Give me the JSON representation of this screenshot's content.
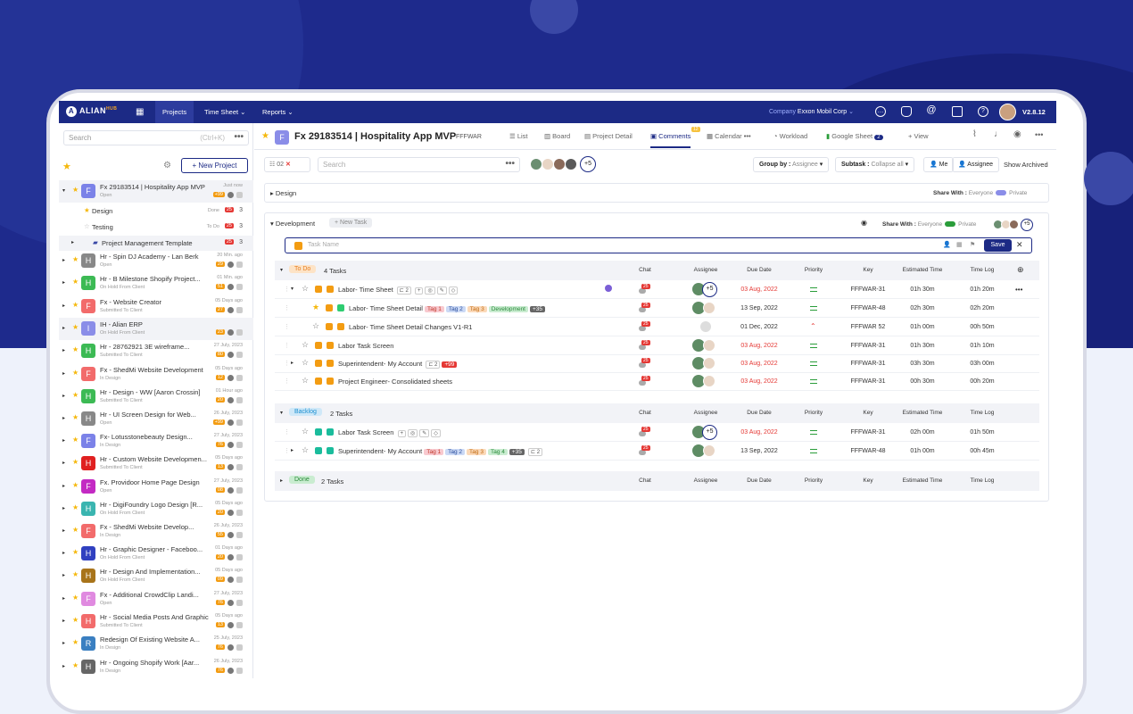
{
  "nav": {
    "logo": "ALIAN",
    "logo_sup": "HUB",
    "tabs": [
      "Projects",
      "Time Sheet",
      "Reports"
    ],
    "company_label": "Company",
    "company_name": "Exxon Mobil Corp",
    "version": "V2.8.12"
  },
  "sidebar": {
    "search_placeholder": "Search",
    "search_shortcut": "(Ctrl+K)",
    "new_project": "+ New Project",
    "projects": [
      {
        "letter": "F",
        "color": "#7b82e8",
        "name": "Fx 29183514 | Hospitality App MVP",
        "status": "Open",
        "time": "Just now",
        "count": "+99"
      },
      {
        "letter": "H",
        "color": "#888888",
        "name": "Hr - Spin DJ Academy - Lan Berk",
        "status": "Open",
        "time": "20 Min. ago",
        "count": "29"
      },
      {
        "letter": "H",
        "color": "#3cba54",
        "name": "Hr - B Milestone Shopify Project...",
        "status": "On Hold From Client",
        "time": "01 Min. ago",
        "count": "51"
      },
      {
        "letter": "F",
        "color": "#f26b6b",
        "name": "Fx - Website Creator",
        "status": "Submitted To Client",
        "time": "05 Days ago",
        "count": "27"
      },
      {
        "letter": "I",
        "color": "#8a8de8",
        "name": "IH - Alian ERP",
        "status": "On Hold From Client",
        "time": "",
        "count": "23"
      },
      {
        "letter": "H",
        "color": "#3cba54",
        "name": "Hr - 28762921 3E wireframe...",
        "status": "Submitted To Client",
        "time": "27 July, 2023",
        "count": "80"
      },
      {
        "letter": "F",
        "color": "#f26b6b",
        "name": "Fx - ShedMi Website Development",
        "status": "In Design",
        "time": "05 Days ago",
        "count": "12"
      },
      {
        "letter": "H",
        "color": "#3cba54",
        "name": "Hr - Design - WW [Aaron Crossin]",
        "status": "Submitted To Client",
        "time": "01 Hour ago",
        "count": "20"
      },
      {
        "letter": "H",
        "color": "#888888",
        "name": "Hr - UI Screen Design for Web...",
        "status": "Open",
        "time": "26 July, 2023",
        "count": "+99"
      },
      {
        "letter": "F",
        "color": "#7b82e8",
        "name": "Fx- Lotusstonebeauty Design...",
        "status": "In Design",
        "time": "27 July, 2023",
        "count": "76"
      },
      {
        "letter": "H",
        "color": "#e02020",
        "name": "Hr - Custom Website Developmen...",
        "status": "Submitted To Client",
        "time": "05 Days ago",
        "count": "13"
      },
      {
        "letter": "F",
        "color": "#c32ac3",
        "name": "Fx. Providoor Home Page Design",
        "status": "Open",
        "time": "27 July, 2023",
        "count": "08"
      },
      {
        "letter": "H",
        "color": "#3ab5b0",
        "name": "Hr - DigiFoundry Logo Design [R...",
        "status": "On Hold From Client",
        "time": "05 Days ago",
        "count": "20"
      },
      {
        "letter": "F",
        "color": "#f26b6b",
        "name": "Fx - ShedMi Website Develop...",
        "status": "In Design",
        "time": "26 July, 2023",
        "count": "55"
      },
      {
        "letter": "H",
        "color": "#3040c0",
        "name": "Hr - Graphic Designer - Faceboo...",
        "status": "On Hold From Client",
        "time": "01 Days ago",
        "count": "20"
      },
      {
        "letter": "H",
        "color": "#a8741a",
        "name": "Hr - Design And Implementation...",
        "status": "On Hold From Client",
        "time": "05 Days ago",
        "count": "09"
      },
      {
        "letter": "F",
        "color": "#e08ae0",
        "name": "Fx - Additional CrowdClip Landi...",
        "status": "Open",
        "time": "27 July, 2023",
        "count": "76"
      },
      {
        "letter": "H",
        "color": "#f26b6b",
        "name": "Hr - Social Media Posts And Graphic",
        "status": "Submitted To Client",
        "time": "05 Days ago",
        "count": "13"
      },
      {
        "letter": "R",
        "color": "#3a7fc1",
        "name": "Redesign Of Existing Website A...",
        "status": "In Design",
        "time": "25 July, 2023",
        "count": "76"
      },
      {
        "letter": "H",
        "color": "#666666",
        "name": "Hr - Ongoing Shopify Work [Aar...",
        "status": "In Design",
        "time": "26 July, 2023",
        "count": "76"
      }
    ],
    "sub": [
      {
        "name": "Design",
        "status": "Done",
        "count": "25",
        "n": "3"
      },
      {
        "name": "Testing",
        "status": "To Do",
        "count": "25",
        "n": "3"
      },
      {
        "name": "Project Management Template",
        "status": "",
        "count": "25",
        "n": "3"
      }
    ]
  },
  "header": {
    "letter": "F",
    "title": "Fx 29183514 | Hospitality App MVP",
    "code": "FFFWAR",
    "tabs": [
      "List",
      "Board",
      "Project Detail",
      "Comments",
      "Calendar",
      "Workload",
      "Google Sheet",
      "+ View"
    ],
    "gs_badge": "2",
    "comments_badge": "12"
  },
  "toolbar": {
    "filter_count": "02",
    "search": "Search",
    "plus": "+5",
    "group_by": "Group by :",
    "group_val": "Assignee",
    "subtask": "Subtask :",
    "subtask_val": "Collapse all",
    "me": "Me",
    "assignee": "Assignee",
    "archived": "Show Archived"
  },
  "design": {
    "label": "Design",
    "share": "Share With :",
    "everyone": "Everyone",
    "private": "Private"
  },
  "development": {
    "label": "Development",
    "new_task": "+ New Task",
    "share": "Share With :",
    "everyone": "Everyone",
    "private": "Private",
    "task_placeholder": "Task Name",
    "save": "Save",
    "plus": "+5"
  },
  "columns": [
    "Chat",
    "Assignee",
    "Due Date",
    "Priority",
    "Key",
    "Estimated Time",
    "Time Log"
  ],
  "todo": {
    "label": "To Do",
    "count": "4 Tasks",
    "tasks": [
      {
        "name": "Labor- Time Sheet",
        "chat": "25",
        "due": "03 Aug, 2022",
        "key": "FFFWAR-31",
        "est": "01h 30m",
        "log": "01h 20m",
        "red": true,
        "sub": "2"
      },
      {
        "name": "Labor- Time Sheet Detail",
        "chat": "25",
        "due": "13 Sep, 2022",
        "key": "FFFWAR-48",
        "est": "02h 30m",
        "log": "02h 20m",
        "red": false
      },
      {
        "name": "Labor- Time Sheet Detail Changes V1-R1",
        "chat": "25",
        "due": "01 Dec, 2022",
        "key": "FFFWAR 52",
        "est": "01h 00m",
        "log": "00h 50m",
        "red": false
      },
      {
        "name": "Labor Task Screen",
        "chat": "25",
        "due": "03 Aug, 2022",
        "key": "FFFWAR-31",
        "est": "01h 30m",
        "log": "01h 10m",
        "red": true
      },
      {
        "name": "Superintendent- My Account",
        "chat": "25",
        "due": "03 Aug, 2022",
        "key": "FFFWAR-31",
        "est": "03h 30m",
        "log": "03h 00m",
        "red": true,
        "sub": "2",
        "subbadge": "+99"
      },
      {
        "name": "Project Engineer- Consolidated sheets",
        "chat": "25",
        "due": "03 Aug, 2022",
        "key": "FFFWAR-31",
        "est": "00h 30m",
        "log": "00h 20m",
        "red": true
      }
    ],
    "tags": [
      "Tag 1",
      "Tag 2",
      "Tag 3",
      "Development",
      "+35"
    ]
  },
  "backlog": {
    "label": "Backlog",
    "count": "2 Tasks",
    "tasks": [
      {
        "name": "Labor Task Screen",
        "chat": "25",
        "due": "03 Aug, 2022",
        "key": "FFFWAR-31",
        "est": "02h 00m",
        "log": "01h 50m",
        "red": true
      },
      {
        "name": "Superintendent- My Account",
        "chat": "25",
        "due": "13 Sep, 2022",
        "key": "FFFWAR-48",
        "est": "01h 00m",
        "log": "00h 45m",
        "red": false,
        "sub": "2"
      }
    ],
    "tags": [
      "Tag 1",
      "Tag 2",
      "Tag 3",
      "Tag 4",
      "+35"
    ],
    "plus": "+5"
  },
  "done": {
    "label": "Done",
    "count": "2 Tasks"
  }
}
